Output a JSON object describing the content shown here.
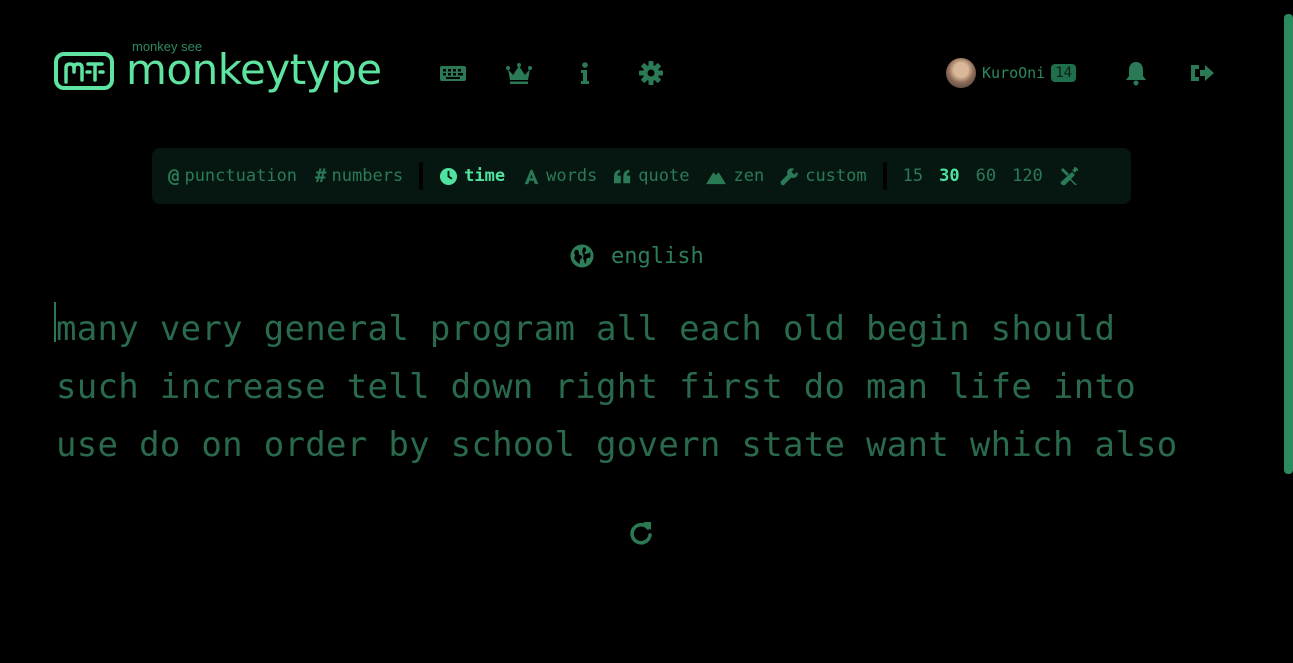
{
  "header": {
    "logo_sub": "monkey see",
    "logo_main": "monkeytype",
    "nav": [
      {
        "name": "keyboard-icon"
      },
      {
        "name": "crown-icon"
      },
      {
        "name": "info-icon"
      },
      {
        "name": "gear-icon"
      }
    ],
    "user": {
      "name": "KuroOni",
      "level": "14"
    },
    "icons": [
      "bell-icon",
      "logout-icon"
    ]
  },
  "config": {
    "toggles": [
      {
        "symbol": "@",
        "label": "punctuation"
      },
      {
        "symbol": "#",
        "label": "numbers"
      }
    ],
    "modes": [
      {
        "label": "time",
        "icon": "clock-icon",
        "active": true
      },
      {
        "label": "words",
        "icon": "font-icon",
        "active": false
      },
      {
        "label": "quote",
        "icon": "quote-icon",
        "active": false
      },
      {
        "label": "zen",
        "icon": "mountain-icon",
        "active": false
      },
      {
        "label": "custom",
        "icon": "wrench-icon",
        "active": false
      }
    ],
    "durations": [
      "15",
      "30",
      "60",
      "120"
    ],
    "active_duration": "30"
  },
  "language": "english",
  "test_words": {
    "line1": "many very general program all each old begin should",
    "line2": "such increase tell down right first do man life into",
    "line3": "use do on order by school govern state want which also"
  },
  "colors": {
    "accent": "#4fe3a0",
    "logo": "#5fe3a1",
    "sub": "#2b7a56",
    "bg": "#000000",
    "config_bg": "#061712"
  }
}
